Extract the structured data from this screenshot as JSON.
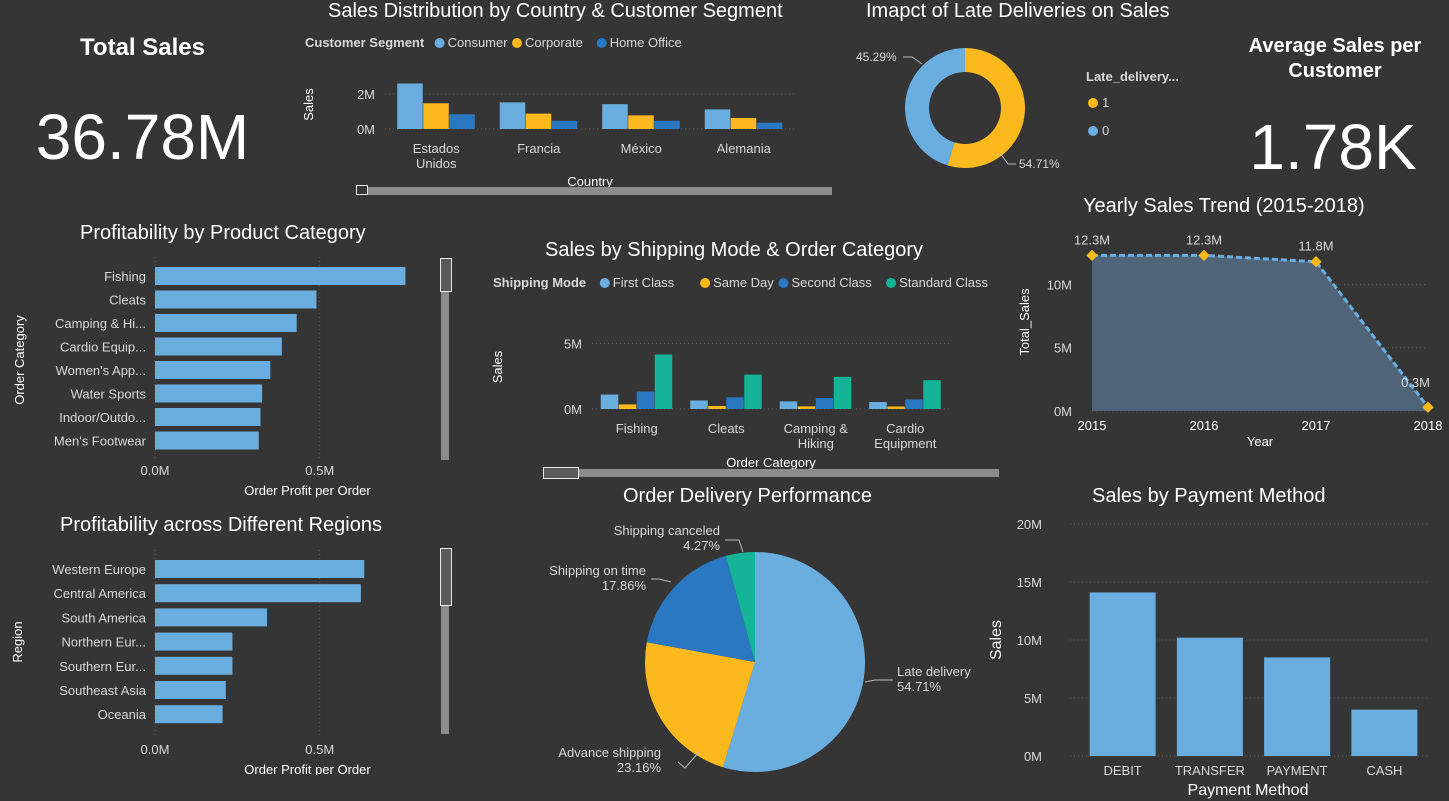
{
  "total_sales": {
    "title": "Total Sales",
    "value": "36.78M"
  },
  "avg_sales": {
    "title": "Average Sales per Customer",
    "value": "1.78K"
  },
  "chart_data": [
    {
      "id": "country_segment",
      "type": "bar",
      "title": "Sales Distribution by Country & Customer Segment",
      "legend_title": "Customer Segment",
      "xlabel": "Country",
      "ylabel": "Sales",
      "categories": [
        [
          "Estados",
          "Unidos"
        ],
        [
          "Francia"
        ],
        [
          "México"
        ],
        [
          "Alemania"
        ]
      ],
      "yticks": [
        {
          "v": 0,
          "label": "0M"
        },
        {
          "v": 2000000,
          "label": "2M"
        }
      ],
      "ylim": [
        0,
        2800000
      ],
      "series": [
        {
          "name": "Consumer",
          "color": "#6aaee0",
          "values": [
            2600000,
            1520000,
            1420000,
            1120000
          ]
        },
        {
          "name": "Corporate",
          "color": "#fbb91e",
          "values": [
            1470000,
            880000,
            780000,
            630000
          ]
        },
        {
          "name": "Home Office",
          "color": "#2b78c2",
          "values": [
            840000,
            470000,
            470000,
            360000
          ]
        }
      ]
    },
    {
      "id": "late_delivery",
      "type": "pie",
      "donut": true,
      "title": "Imapct of Late Deliveries on Sales",
      "legend_title": "Late_delivery...",
      "slices": [
        {
          "name": "1",
          "value": 54.71,
          "label": "54.71%",
          "color": "#fbb91e"
        },
        {
          "name": "0",
          "value": 45.29,
          "label": "45.29%",
          "color": "#6aaee0"
        }
      ]
    },
    {
      "id": "category_profit",
      "type": "bar",
      "orientation": "horizontal",
      "title": "Profitability by Product Category",
      "xlabel": "Order Profit per Order",
      "ylabel": "Order Category",
      "categories": [
        "Fishing",
        "Cleats",
        "Camping & Hi...",
        "Cardio Equip...",
        "Women's App...",
        "Water Sports",
        "Indoor/Outdo...",
        "Men's Footwear"
      ],
      "values": [
        760000,
        490000,
        430000,
        385000,
        350000,
        325000,
        320000,
        315000
      ],
      "xticks": [
        {
          "v": 0,
          "label": "0.0M"
        },
        {
          "v": 500000,
          "label": "0.5M"
        }
      ],
      "xlim": [
        0,
        780000
      ],
      "color": "#6aaee0"
    },
    {
      "id": "region_profit",
      "type": "bar",
      "orientation": "horizontal",
      "title": "Profitability across Different Regions",
      "xlabel": "Order Profit per Order",
      "ylabel": "Region",
      "categories": [
        "Western Europe",
        "Central America",
        "South America",
        "Northern Eur...",
        "Southern Eur...",
        "Southeast Asia",
        "Oceania"
      ],
      "values": [
        635000,
        625000,
        340000,
        235000,
        235000,
        215000,
        205000
      ],
      "xticks": [
        {
          "v": 0,
          "label": "0.0M"
        },
        {
          "v": 500000,
          "label": "0.5M"
        }
      ],
      "xlim": [
        0,
        780000
      ],
      "color": "#6aaee0"
    },
    {
      "id": "shipping_mode",
      "type": "bar",
      "title": "Sales by Shipping Mode & Order Category",
      "legend_title": "Shipping Mode",
      "xlabel": "Order Category",
      "ylabel": "Sales",
      "categories": [
        [
          "Fishing"
        ],
        [
          "Cleats"
        ],
        [
          "Camping &",
          "Hiking"
        ],
        [
          "Cardio",
          "Equipment"
        ]
      ],
      "yticks": [
        {
          "v": 0,
          "label": "0M"
        },
        {
          "v": 5000000,
          "label": "5M"
        }
      ],
      "ylim": [
        0,
        6400000
      ],
      "series": [
        {
          "name": "First Class",
          "color": "#6aaee0",
          "values": [
            1100000,
            650000,
            580000,
            530000
          ]
        },
        {
          "name": "Same Day",
          "color": "#fbb91e",
          "values": [
            350000,
            230000,
            200000,
            190000
          ]
        },
        {
          "name": "Second Class",
          "color": "#2b78c2",
          "values": [
            1330000,
            890000,
            830000,
            730000
          ]
        },
        {
          "name": "Standard Class",
          "color": "#15b498",
          "values": [
            4150000,
            2620000,
            2450000,
            2200000
          ]
        }
      ]
    },
    {
      "id": "yearly_trend",
      "type": "area",
      "title": "Yearly Sales Trend (2015-2018)",
      "xlabel": "Year",
      "ylabel": "Total_Sales",
      "x": [
        2015,
        2016,
        2017,
        2018
      ],
      "values": [
        12300000,
        12300000,
        11800000,
        300000
      ],
      "data_labels": [
        "12.3M",
        "12.3M",
        "11.8M",
        "0.3M"
      ],
      "yticks": [
        {
          "v": 0,
          "label": "0M"
        },
        {
          "v": 5000000,
          "label": "5M"
        },
        {
          "v": 10000000,
          "label": "10M"
        }
      ],
      "ylim": [
        0,
        13200000
      ]
    },
    {
      "id": "delivery_perf",
      "type": "pie",
      "title": "Order Delivery Performance",
      "slices": [
        {
          "name": "Late delivery",
          "value": 54.71,
          "label": "54.71%",
          "color": "#6aaee0"
        },
        {
          "name": "Advance shipping",
          "value": 23.16,
          "label": "23.16%",
          "color": "#fbb91e"
        },
        {
          "name": "Shipping on time",
          "value": 17.86,
          "label": "17.86%",
          "color": "#2b78c2"
        },
        {
          "name": "Shipping canceled",
          "value": 4.27,
          "label": "4.27%",
          "color": "#15b498"
        }
      ]
    },
    {
      "id": "payment",
      "type": "bar",
      "title": "Sales by Payment Method",
      "xlabel": "Payment Method",
      "ylabel": "Sales",
      "categories": [
        "DEBIT",
        "TRANSFER",
        "PAYMENT",
        "CASH"
      ],
      "values": [
        14100000,
        10200000,
        8500000,
        4000000
      ],
      "yticks": [
        {
          "v": 0,
          "label": "0M"
        },
        {
          "v": 5000000,
          "label": "5M"
        },
        {
          "v": 10000000,
          "label": "10M"
        },
        {
          "v": 15000000,
          "label": "15M"
        },
        {
          "v": 20000000,
          "label": "20M"
        }
      ],
      "ylim": [
        0,
        20000000
      ],
      "color": "#6aaee0"
    }
  ]
}
